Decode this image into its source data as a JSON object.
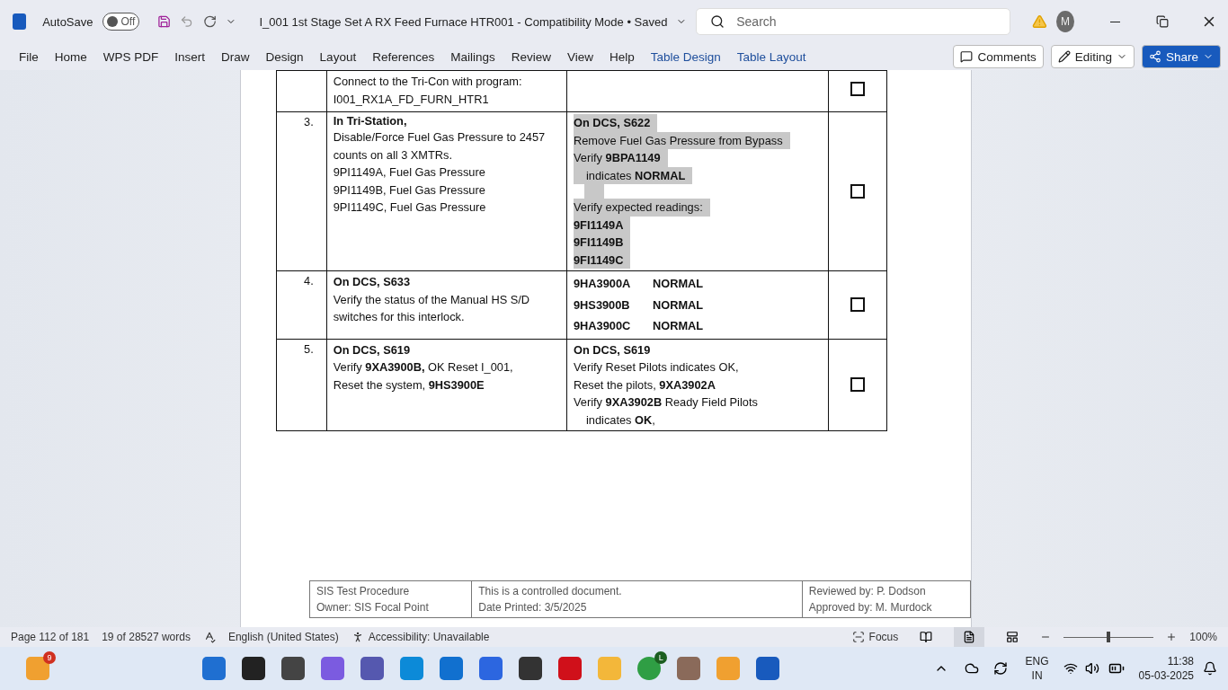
{
  "title_bar": {
    "autosave": {
      "label": "AutoSave",
      "state_text": "Off",
      "on": false
    },
    "title": "I_001 1st Stage Set A RX Feed Furnace HTR001  -  Compatibility Mode • Saved",
    "search": {
      "placeholder": "Search"
    },
    "avatar": "M"
  },
  "ribbon": {
    "tabs": [
      {
        "label": "File",
        "kind": "normal"
      },
      {
        "label": "Home",
        "kind": "normal"
      },
      {
        "label": "WPS PDF",
        "kind": "normal"
      },
      {
        "label": "Insert",
        "kind": "normal"
      },
      {
        "label": "Draw",
        "kind": "normal"
      },
      {
        "label": "Design",
        "kind": "normal"
      },
      {
        "label": "Layout",
        "kind": "normal"
      },
      {
        "label": "References",
        "kind": "normal"
      },
      {
        "label": "Mailings",
        "kind": "normal"
      },
      {
        "label": "Review",
        "kind": "normal"
      },
      {
        "label": "View",
        "kind": "normal"
      },
      {
        "label": "Help",
        "kind": "normal"
      },
      {
        "label": "Table Design",
        "kind": "contextual"
      },
      {
        "label": "Table Layout",
        "kind": "contextual"
      }
    ],
    "comments": "Comments",
    "editing": "Editing",
    "share": "Share"
  },
  "procedure_table": {
    "rows": [
      {
        "step": null,
        "checked": false,
        "action": [
          {
            "text": "Connect to the Tri-Con with program:"
          },
          {
            "text": "I001_RX1A_FD_FURN_HTR1"
          }
        ],
        "verify": []
      },
      {
        "step": "3.",
        "checked": false,
        "action": [
          {
            "text": "**In Tri-Station,**"
          },
          {
            "text": "Disable/Force Fuel Gas Pressure to 2457 counts on all 3 XMTRs."
          },
          {
            "text": "9PI1149A, Fuel Gas Pressure"
          },
          {
            "text": "9PI1149B, Fuel Gas Pressure"
          },
          {
            "text": "9PI1149C, Fuel Gas Pressure"
          }
        ],
        "verify": [
          {
            "kind": "line",
            "text": "**On DCS, S622**",
            "highlight": true,
            "indent": false
          },
          {
            "kind": "line",
            "text": "Remove Fuel Gas Pressure from Bypass",
            "highlight": true,
            "indent": false
          },
          {
            "kind": "line",
            "text": "Verify **9BPA1149**",
            "highlight": true,
            "indent": false
          },
          {
            "kind": "line",
            "text": "indicates **NORMAL**",
            "highlight": true,
            "indent": true
          },
          {
            "kind": "blank",
            "highlight": true,
            "indent": true
          },
          {
            "kind": "line",
            "text": "Verify expected readings:",
            "highlight": true,
            "indent": false
          },
          {
            "kind": "line",
            "text": "**9FI1149A**",
            "highlight": true,
            "indent": false
          },
          {
            "kind": "line",
            "text": "**9FI1149B**",
            "highlight": true,
            "indent": false
          },
          {
            "kind": "line",
            "text": "**9FI1149C**",
            "highlight": true,
            "indent": false
          }
        ]
      },
      {
        "step": "4.",
        "checked": false,
        "action": [
          {
            "text": "**On DCS, S633**"
          },
          {
            "text": "Verify the status of the Manual HS S/D switches for this interlock."
          }
        ],
        "verify": [
          {
            "kind": "pair",
            "tag": "9HA3900A",
            "status": "NORMAL"
          },
          {
            "kind": "pair",
            "tag": "9HS3900B",
            "status": "NORMAL"
          },
          {
            "kind": "pair",
            "tag": "9HA3900C",
            "status": "NORMAL"
          }
        ]
      },
      {
        "step": "5.",
        "checked": false,
        "action": [
          {
            "text": "**On DCS, S619**"
          },
          {
            "text": "Verify **9XA3900B,** OK Reset I_001,"
          },
          {
            "text": "Reset the system, **9HS3900E**"
          }
        ],
        "verify": [
          {
            "kind": "line",
            "text": "**On DCS, S619**",
            "highlight": false,
            "indent": false
          },
          {
            "kind": "line",
            "text": "Verify Reset Pilots indicates OK,",
            "highlight": false,
            "indent": false
          },
          {
            "kind": "line",
            "text": "Reset the pilots, **9XA3902A**",
            "highlight": false,
            "indent": false
          },
          {
            "kind": "line",
            "text": "Verify **9XA3902B** Ready Field Pilots",
            "highlight": false,
            "indent": false
          },
          {
            "kind": "line",
            "text": "indicates **OK**,",
            "highlight": false,
            "indent": true
          }
        ]
      }
    ]
  },
  "page_footer": [
    [
      "SIS Test Procedure",
      "Owner: SIS Focal Point"
    ],
    [
      "This is a controlled document.",
      "Date Printed: 3/5/2025"
    ],
    [
      "Reviewed by: P. Dodson",
      "Approved by: M. Murdock"
    ]
  ],
  "status_bar": {
    "page": "Page 112 of 181",
    "words": "19 of 28527 words",
    "language": "English (United States)",
    "accessibility": "Accessibility: Unavailable",
    "focus": "Focus",
    "zoom_slider": {
      "level": 0.5
    },
    "zoom": "100%"
  },
  "taskbar": {
    "weather_badge": "9",
    "chrome_badge": "L",
    "language": "ENG",
    "region": "IN",
    "time": "11:38",
    "date": "05-03-2025"
  }
}
